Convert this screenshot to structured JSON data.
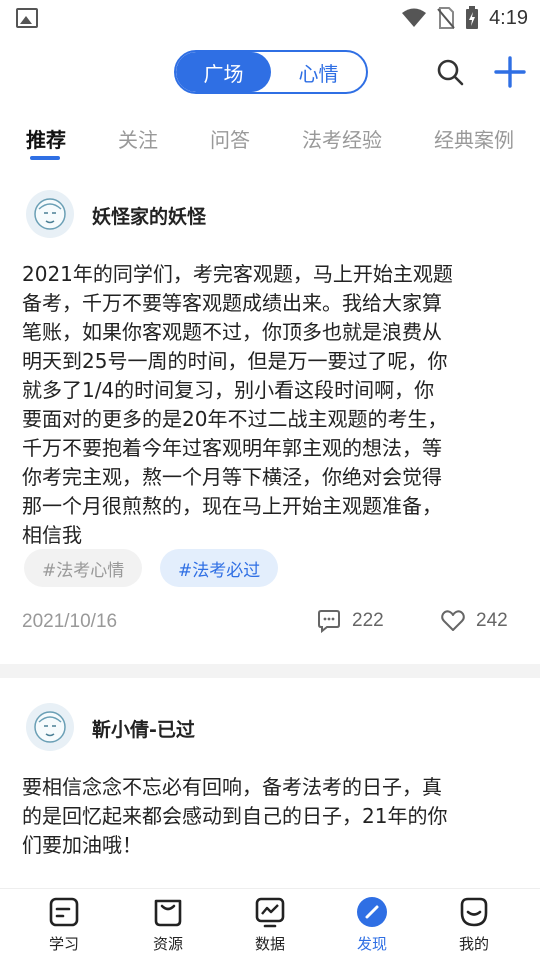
{
  "status_bar": {
    "time": "4:19"
  },
  "top": {
    "segments": [
      "广场",
      "心情"
    ],
    "active_segment": "广场"
  },
  "tabs": [
    "推荐",
    "关注",
    "问答",
    "法考经验",
    "经典案例"
  ],
  "active_tab": "推荐",
  "posts": [
    {
      "author": "妖怪家的妖怪",
      "body_lines": [
        "2021年的同学们，考完客观题，马上开始主观题",
        "备考，千万不要等客观题成绩出来。我给大家算",
        "笔账，如果你客观题不过，你顶多也就是浪费从",
        "明天到25号一周的时间，但是万一要过了呢，你",
        "就多了1/4的时间复习，别小看这段时间啊，你",
        "要面对的更多的是20年不过二战主观题的考生，",
        "千万不要抱着今年过客观明年郭主观的想法，等",
        "你考完主观，熬一个月等下横泾，你绝对会觉得",
        "那一个月很煎熬的，现在马上开始主观题准备，",
        "相信我"
      ],
      "tags": [
        "#法考心情",
        "#法考必过"
      ],
      "date": "2021/10/16",
      "comments": "222",
      "likes": "242"
    },
    {
      "author": "靳小倩-已过",
      "body_lines": [
        "要相信念念不忘必有回响，备考法考的日子，真",
        "的是回忆起来都会感动到自己的日子，21年的你",
        "们要加油哦！"
      ]
    }
  ],
  "bottom_nav": [
    {
      "label": "学习",
      "icon": "study-icon"
    },
    {
      "label": "资源",
      "icon": "resources-icon"
    },
    {
      "label": "数据",
      "icon": "data-icon"
    },
    {
      "label": "发现",
      "icon": "discover-icon"
    },
    {
      "label": "我的",
      "icon": "profile-icon"
    }
  ],
  "active_nav": "发现",
  "colors": {
    "accent": "#2f6fe4",
    "muted": "#999999",
    "tag_bg": "#f2f2f2",
    "tag_blue_bg": "#e3eefc"
  }
}
